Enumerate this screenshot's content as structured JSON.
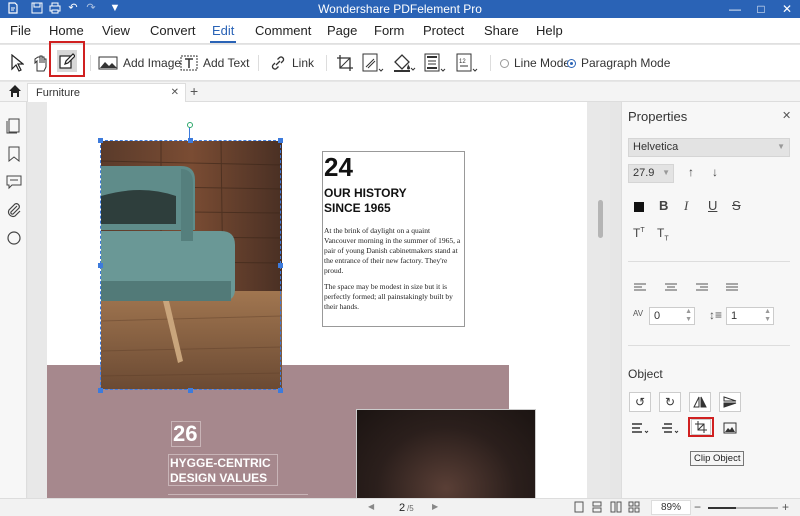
{
  "app": {
    "title": "Wondershare PDFelement Pro"
  },
  "menu": [
    "File",
    "Home",
    "View",
    "Convert",
    "Edit",
    "Comment",
    "Page",
    "Form",
    "Protect",
    "Share",
    "Help"
  ],
  "toolbar": {
    "add_image": "Add Image",
    "add_text": "Add Text",
    "link": "Link",
    "line_mode": "Line Mode",
    "paragraph_mode": "Paragraph Mode"
  },
  "tab": {
    "name": "Furniture"
  },
  "document": {
    "number_1": "24",
    "heading_1": "OUR HISTORY SINCE 1965",
    "para_1": "At the brink of daylight on a quaint Vancouver morning in the summer of 1965, a pair of young Danish cabinetmakers stand at the entrance of their new factory. They're proud.",
    "para_2": "The space may be modest in size but it is perfectly formed; all painstakingly built by their hands.",
    "number_2": "26",
    "heading_2": "HYGGE-CENTRIC DESIGN VALUES"
  },
  "properties": {
    "title": "Properties",
    "font": "Helvetica",
    "size": "27.9",
    "char_spacing": "0",
    "line_spacing": "1",
    "object_label": "Object",
    "tooltip": "Clip Object"
  },
  "status": {
    "page_current": "2",
    "page_total": "/5",
    "zoom": "89%"
  },
  "colors": {
    "accent": "#2a63b6",
    "highlight": "#d02020",
    "mauve_block": "#a6888d"
  }
}
